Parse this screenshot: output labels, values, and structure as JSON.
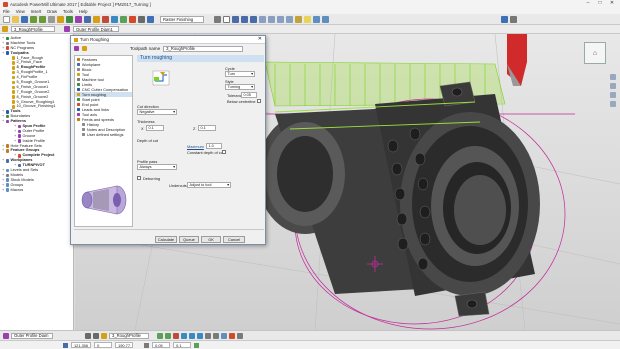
{
  "app": {
    "title": "Autodesk PowerMill Ultimate 2017  [ Editable Project ] PM2017_Turning ]",
    "window_controls": [
      "–",
      "□",
      "✕"
    ]
  },
  "menu": [
    "File",
    "View",
    "Insert",
    "Draw",
    "Tools",
    "Help"
  ],
  "toolbar": {
    "roughing_combo": "Raster Finishing",
    "toolpath_combo": "3_RoughProfile",
    "profile_combo": "Outer Profile Diam1"
  },
  "explorer": {
    "items": [
      {
        "label": "Active",
        "color": "#2d8a2d",
        "indent": 0
      },
      {
        "label": "Machine Tools",
        "color": "#7a7a7a",
        "indent": 0
      },
      {
        "label": "NC Programs",
        "color": "#d24a2a",
        "indent": 0
      },
      {
        "label": "Toolpaths",
        "color": "#1f5fae",
        "indent": 0,
        "bold": true
      },
      {
        "label": "1_Face_Rough",
        "color": "#d4a017",
        "indent": 1
      },
      {
        "label": "2_Finish_Face",
        "color": "#d4a017",
        "indent": 1
      },
      {
        "label": "3_RoughProfile",
        "color": "#d4a017",
        "indent": 1,
        "bold": true
      },
      {
        "label": "3_RoughProfile_1",
        "color": "#d4a017",
        "indent": 1
      },
      {
        "label": "4_FinProfile",
        "color": "#d4a017",
        "indent": 1
      },
      {
        "label": "5_Rough_Groove1",
        "color": "#d4a017",
        "indent": 1
      },
      {
        "label": "6_Finish_Groove1",
        "color": "#d4a017",
        "indent": 1
      },
      {
        "label": "7_Rough_Groove2",
        "color": "#d4a017",
        "indent": 1
      },
      {
        "label": "8_Finish_Groove2",
        "color": "#d4a017",
        "indent": 1
      },
      {
        "label": "9_Groove_Roughing1",
        "color": "#d4a017",
        "indent": 1
      },
      {
        "label": "10_Groove_Finishing1",
        "color": "#d4a017",
        "indent": 1
      },
      {
        "label": "Tools",
        "color": "#1f5fae",
        "indent": 0,
        "bold": true
      },
      {
        "label": "Boundaries",
        "color": "#3f8f3f",
        "indent": 0
      },
      {
        "label": "Patterns",
        "color": "#9c3fae",
        "indent": 0,
        "bold": true
      },
      {
        "label": "Spun Profile",
        "color": "#9c3fae",
        "indent": 2,
        "bold": true
      },
      {
        "label": "Outer Profile",
        "color": "#9c3fae",
        "indent": 2
      },
      {
        "label": "Groove",
        "color": "#9c3fae",
        "indent": 2
      },
      {
        "label": "Inside Profile",
        "color": "#9c3fae",
        "indent": 2
      },
      {
        "label": "Hole Feature Sets",
        "color": "#c27a22",
        "indent": 0
      },
      {
        "label": "Feature Groups",
        "color": "#c27a22",
        "indent": 0,
        "bold": true
      },
      {
        "label": "Complete Project",
        "color": "#d24a2a",
        "indent": 2,
        "bold": true
      },
      {
        "label": "Workplanes",
        "color": "#4a6ba8",
        "indent": 0,
        "bold": true
      },
      {
        "label": "TURNPIVOT",
        "color": "#4a6ba8",
        "indent": 2,
        "bold": true
      },
      {
        "label": "Levels and Sets",
        "color": "#5f8fbf",
        "indent": 0
      },
      {
        "label": "Models",
        "color": "#7a7a7a",
        "indent": 0
      },
      {
        "label": "Stock Models",
        "color": "#5f8fbf",
        "indent": 0
      },
      {
        "label": "Groups",
        "color": "#5f8fbf",
        "indent": 0
      },
      {
        "label": "Macros",
        "color": "#5f8fbf",
        "indent": 0
      }
    ]
  },
  "dialog": {
    "title": "Turn Roughing",
    "close": "✕",
    "toolpath_name_label": "Toolpath name",
    "toolpath_name": "3_RoughProfile",
    "page_title": "Turn roughing",
    "nav": [
      {
        "label": "Features",
        "color": "#c27a22",
        "indent": 0
      },
      {
        "label": "Workplane",
        "color": "#4a6ba8",
        "indent": 0
      },
      {
        "label": "Block",
        "color": "#8a8a8a",
        "indent": 0
      },
      {
        "label": "Tool",
        "color": "#d4a017",
        "indent": 0
      },
      {
        "label": "Machine tool",
        "color": "#7a7a7a",
        "indent": 0
      },
      {
        "label": "Limits",
        "color": "#3f8f3f",
        "indent": 0
      },
      {
        "label": "CNC Cutter Compensation",
        "color": "#1f5fae",
        "indent": 0
      },
      {
        "label": "Turn roughing",
        "color": "#d4a017",
        "indent": 0,
        "selected": true
      },
      {
        "label": "Start point",
        "color": "#3f8f3f",
        "indent": 0
      },
      {
        "label": "End point",
        "color": "#d24a2a",
        "indent": 0
      },
      {
        "label": "Leads and links",
        "color": "#1f5fae",
        "indent": 0
      },
      {
        "label": "Tool axis",
        "color": "#9c3fae",
        "indent": 0
      },
      {
        "label": "Feeds and speeds",
        "color": "#c27a22",
        "indent": 0
      },
      {
        "label": "History",
        "color": "#8a8a8a",
        "indent": 1
      },
      {
        "label": "Notes and Description",
        "color": "#8a8a8a",
        "indent": 1
      },
      {
        "label": "User defined settings",
        "color": "#8a8a8a",
        "indent": 1
      }
    ],
    "cycle_label": "Cycle",
    "cycle_value": "Turn",
    "style_label": "Style",
    "style_value": "Turning",
    "tolerance_label": "Tolerance",
    "tolerance_value": "0.05",
    "below_centreline_label": "Below centreline",
    "cut_direction_label": "Cut direction",
    "cut_direction_value": "Negative",
    "thickness_label": "Thickness",
    "thickness_x_label": "X",
    "thickness_x": "0.1",
    "thickness_z_label": "Z",
    "thickness_z": "0.1",
    "depth_of_cut_label": "Depth of cut",
    "maximum_label": "Maximum",
    "maximum_value": "1.0",
    "constant_depth_label": "Constant depth of cut",
    "profile_pass_label": "Profile pass",
    "profile_pass_value": "Always",
    "deburring_label": "Deburring",
    "undercuts_label": "Undercuts",
    "undercuts_value": "Adjust to tool",
    "buttons": [
      "Calculate",
      "Queue",
      "OK",
      "Cancel"
    ]
  },
  "viewport": {
    "viewcube_label": "⌂"
  },
  "bottombar": {
    "profile_combo": "Outer Profile Diam",
    "rough_combo": "3_RoughProfile"
  },
  "status": {
    "x": "121.306",
    "y": "0",
    "z": "190.77",
    "tol": "0.05",
    "stepover": "0.1"
  },
  "colors": {
    "accent": "#1d4f8d",
    "toolpath_green": "#7ed321",
    "part_dark": "#3a3a3a",
    "boundary_magenta": "#c22a9a",
    "tool_red": "#d02a2a"
  }
}
